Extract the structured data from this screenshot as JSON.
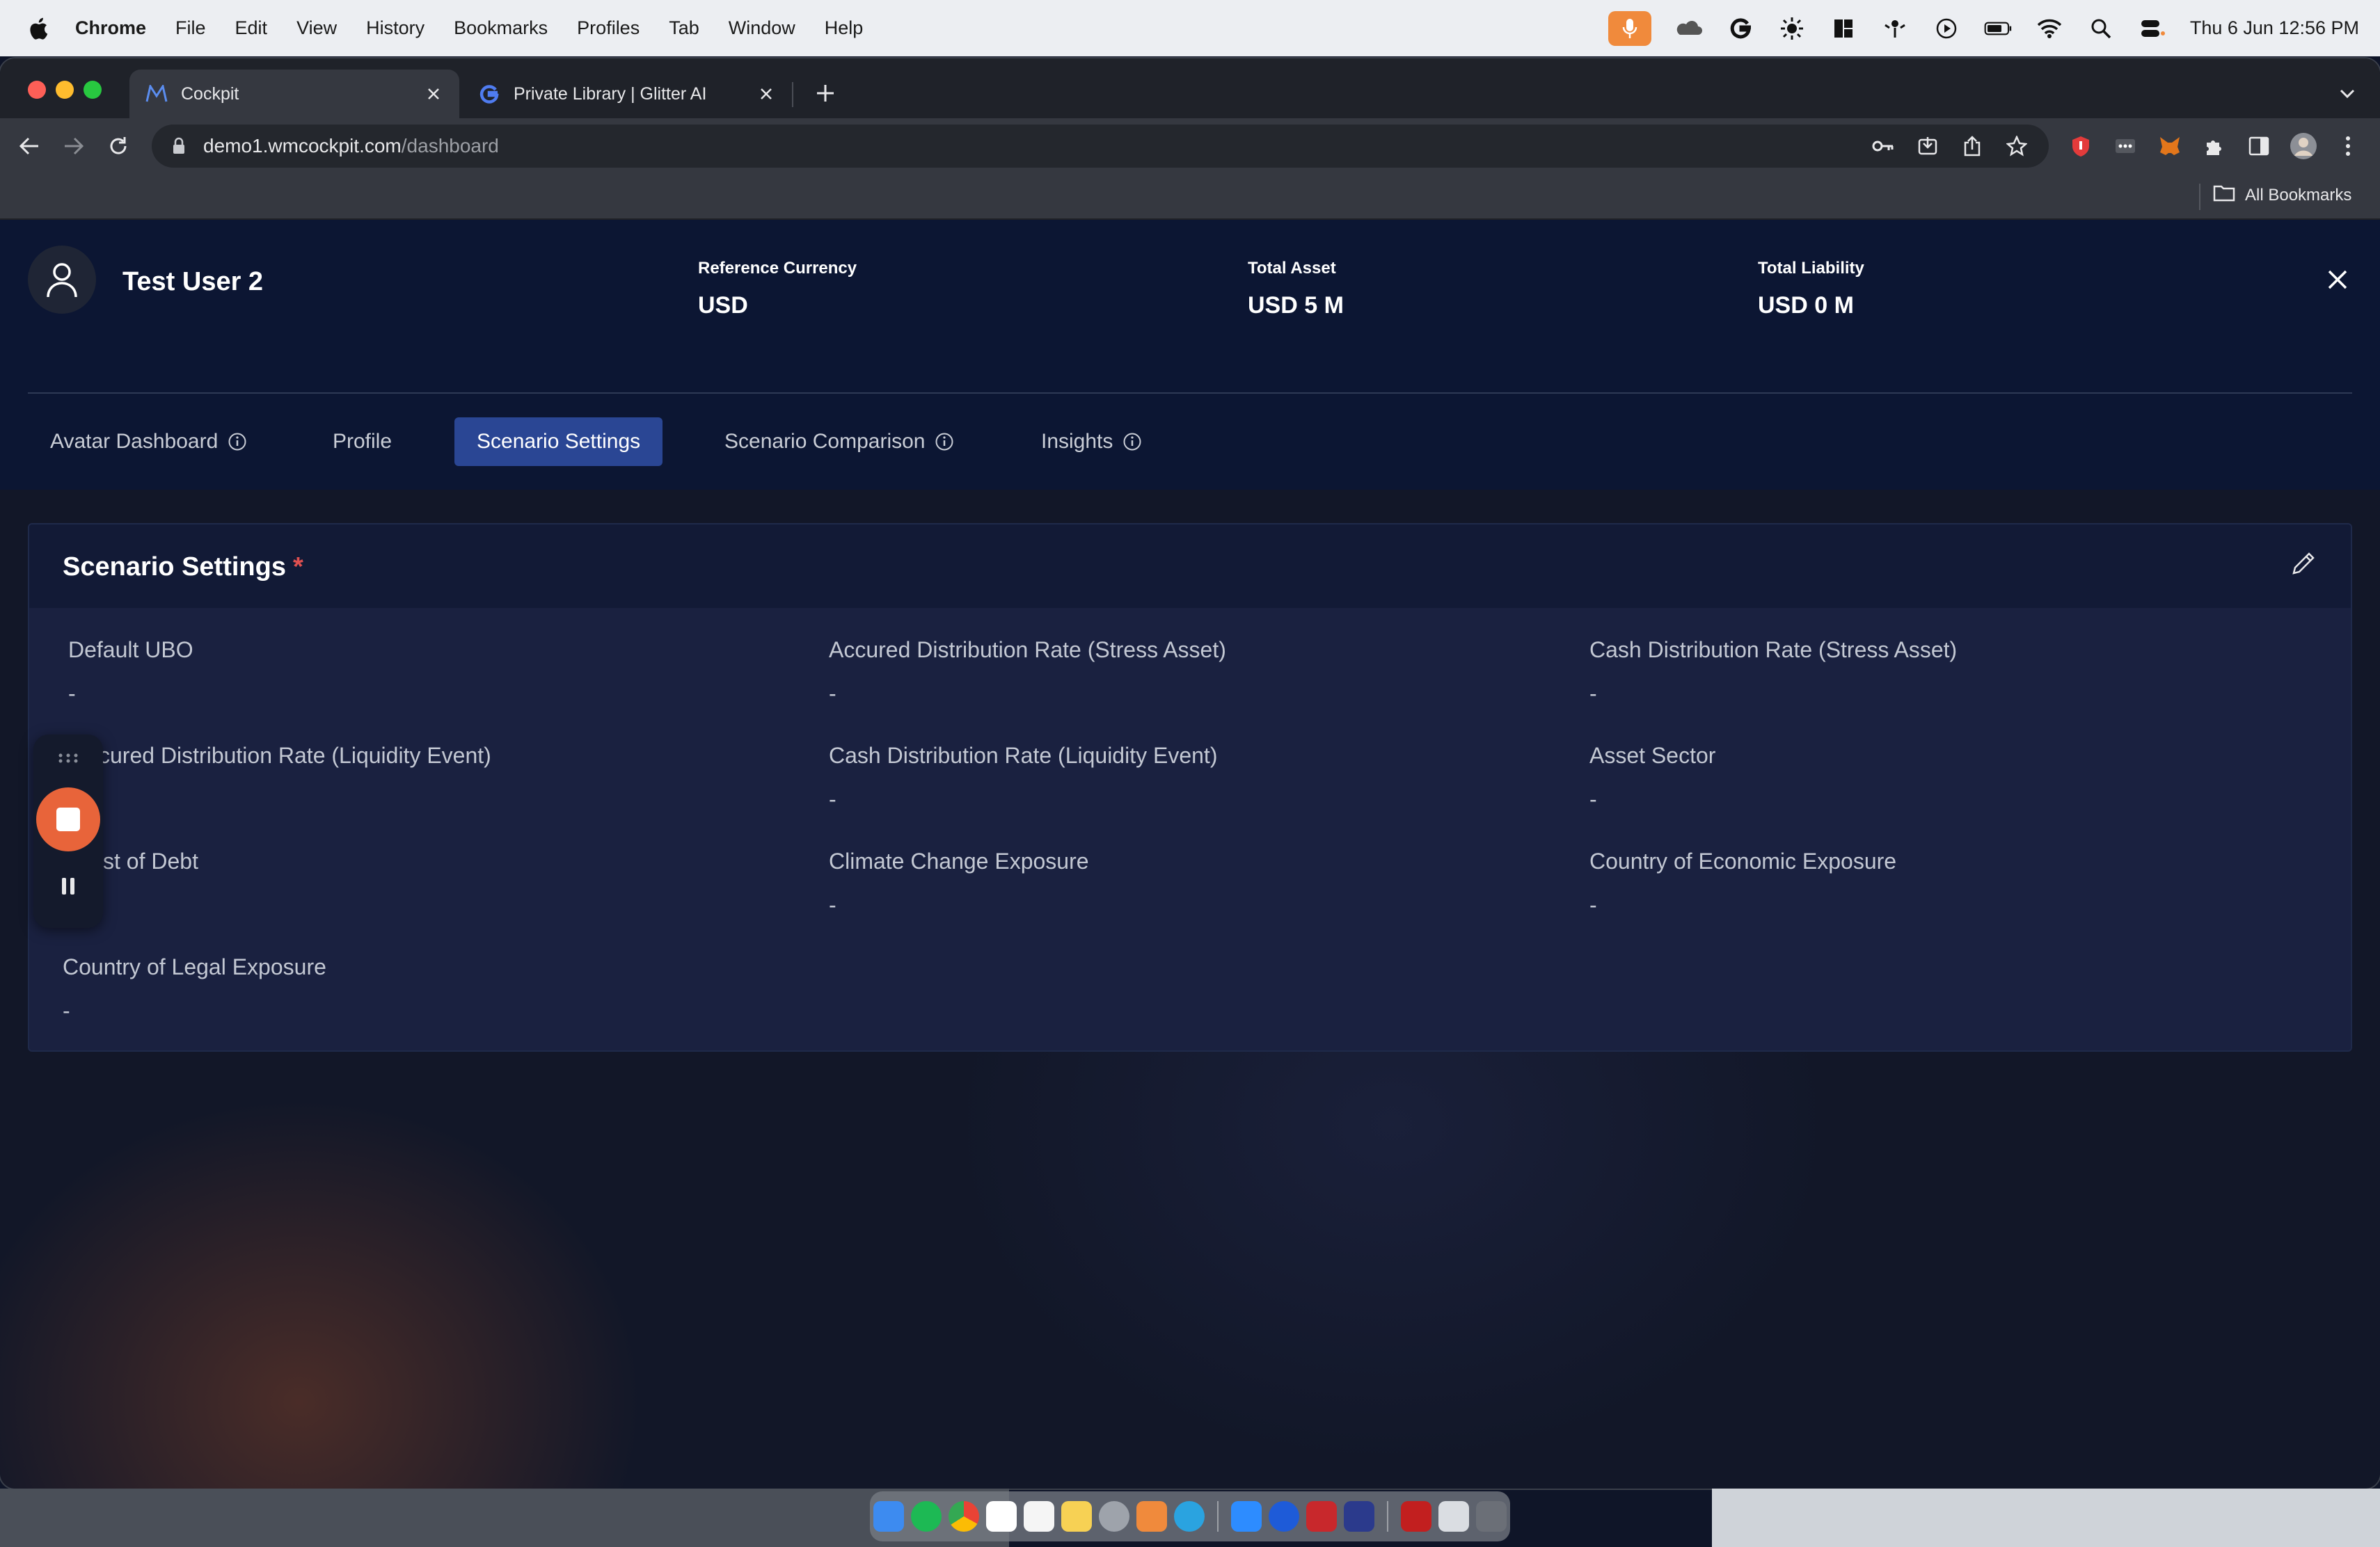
{
  "menubar": {
    "app_name": "Chrome",
    "items": [
      "File",
      "Edit",
      "View",
      "History",
      "Bookmarks",
      "Profiles",
      "Tab",
      "Window",
      "Help"
    ],
    "clock": "Thu 6 Jun  12:56 PM"
  },
  "browser": {
    "tabs": [
      {
        "title": "Cockpit",
        "active": true
      },
      {
        "title": "Private Library | Glitter AI",
        "active": false
      }
    ],
    "url_host": "demo1.wmcockpit.com",
    "url_path": "/dashboard",
    "bookmarks_label": "All Bookmarks"
  },
  "header": {
    "user_name": "Test User 2",
    "kpis": [
      {
        "label": "Reference Currency",
        "value": "USD"
      },
      {
        "label": "Total Asset",
        "value": "USD 5 M"
      },
      {
        "label": "Total Liability",
        "value": "USD 0 M"
      }
    ],
    "nav_tabs": [
      {
        "label": "Avatar Dashboard",
        "info": true
      },
      {
        "label": "Profile",
        "info": false
      },
      {
        "label": "Scenario Settings",
        "info": false,
        "active": true
      },
      {
        "label": "Scenario Comparison",
        "info": true
      },
      {
        "label": "Insights",
        "info": true
      }
    ]
  },
  "card": {
    "title": "Scenario Settings",
    "required_mark": "*",
    "fields": [
      {
        "label": "Default UBO",
        "value": "-"
      },
      {
        "label": "Accured Distribution Rate (Stress Asset)",
        "value": "-"
      },
      {
        "label": "Cash Distribution Rate (Stress Asset)",
        "value": "-"
      },
      {
        "label": "cured Distribution Rate (Liquidity Event)",
        "value": ""
      },
      {
        "label": "Cash Distribution Rate (Liquidity Event)",
        "value": "-"
      },
      {
        "label": "Asset Sector",
        "value": "-"
      },
      {
        "label": "st of Debt",
        "value": ""
      },
      {
        "label": "Climate Change Exposure",
        "value": "-"
      },
      {
        "label": "Country of Economic Exposure",
        "value": "-"
      },
      {
        "label": "Country of Legal Exposure",
        "value": "-"
      }
    ]
  },
  "colors": {
    "accent": "#2a4694",
    "header_bg": "#0c1633",
    "card_bg": "#1a2140",
    "record_button": "#e8643a",
    "required": "#e05050"
  }
}
